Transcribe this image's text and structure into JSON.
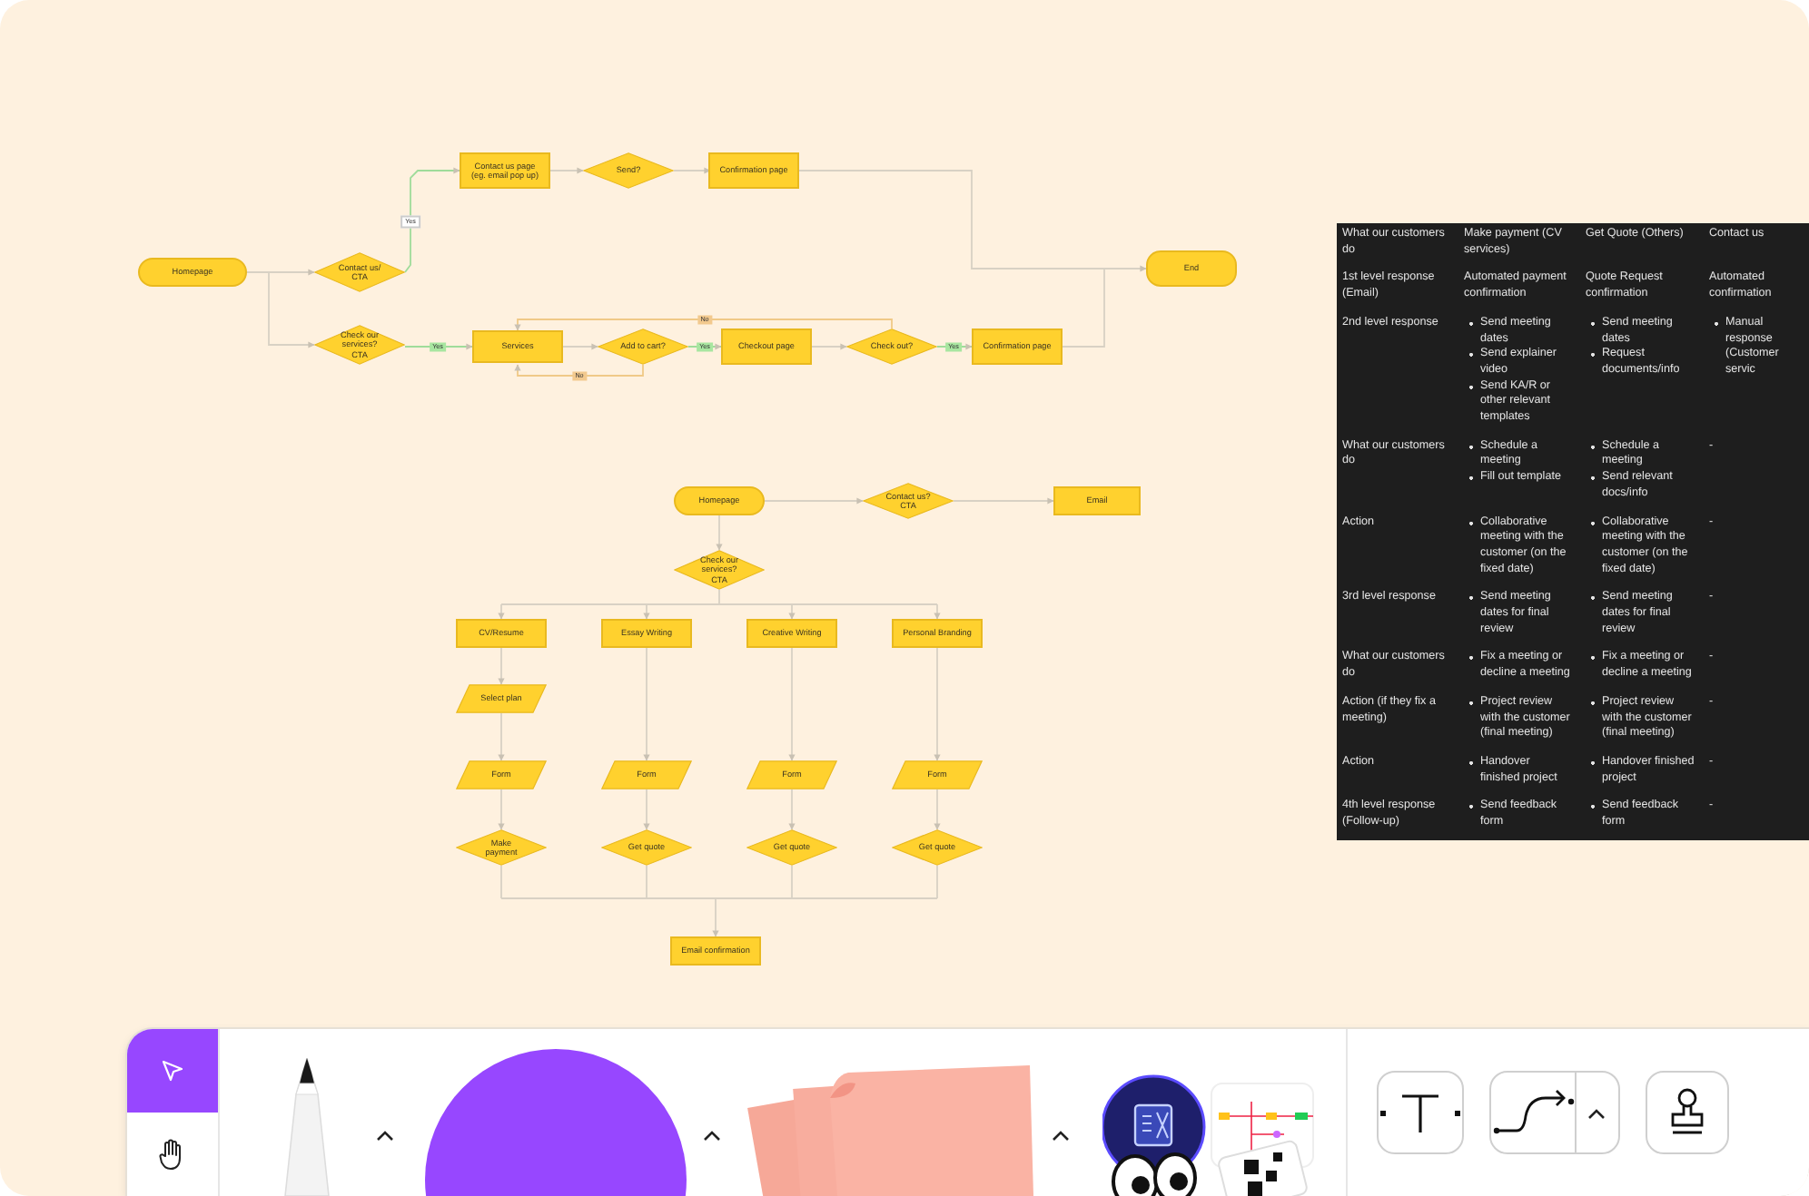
{
  "flowcharts": [
    {
      "nodes": [
        {
          "kind": "terminal",
          "label": "Homepage"
        },
        {
          "kind": "decision",
          "label": "Contact us/ CTA"
        },
        {
          "kind": "decision",
          "label": "Check our services? CTA"
        },
        {
          "kind": "process",
          "label": "Contact us page (eg. email pop up)"
        },
        {
          "kind": "decision",
          "label": "Send?"
        },
        {
          "kind": "process",
          "label": "Confirmation page"
        },
        {
          "kind": "terminal",
          "label": "End"
        },
        {
          "kind": "process",
          "label": "Services"
        },
        {
          "kind": "decision",
          "label": "Add to cart?"
        },
        {
          "kind": "process",
          "label": "Checkout page"
        },
        {
          "kind": "decision",
          "label": "Check out?"
        },
        {
          "kind": "process",
          "label": "Confirmation page"
        }
      ],
      "edge_labels": [
        {
          "kind": "plain",
          "label": "Yes"
        },
        {
          "kind": "yes",
          "label": "Yes"
        },
        {
          "kind": "no",
          "label": "No"
        },
        {
          "kind": "yes",
          "label": "Yes"
        },
        {
          "kind": "no",
          "label": "No"
        },
        {
          "kind": "yes",
          "label": "Yes"
        }
      ]
    },
    {
      "nodes": [
        {
          "kind": "terminal",
          "label": "Homepage"
        },
        {
          "kind": "decision",
          "label": "Contact us? CTA"
        },
        {
          "kind": "process",
          "label": "Email"
        },
        {
          "kind": "decision",
          "label": "Check our services? CTA"
        },
        {
          "kind": "process",
          "label": "CV/Resume"
        },
        {
          "kind": "process",
          "label": "Essay Writing"
        },
        {
          "kind": "process",
          "label": "Creative Writing"
        },
        {
          "kind": "process",
          "label": "Personal Branding"
        },
        {
          "kind": "data",
          "label": "Select plan"
        },
        {
          "kind": "data",
          "label": "Form"
        },
        {
          "kind": "data",
          "label": "Form"
        },
        {
          "kind": "data",
          "label": "Form"
        },
        {
          "kind": "data",
          "label": "Form"
        },
        {
          "kind": "decision",
          "label": "Make payment"
        },
        {
          "kind": "decision",
          "label": "Get quote"
        },
        {
          "kind": "decision",
          "label": "Get quote"
        },
        {
          "kind": "decision",
          "label": "Get quote"
        },
        {
          "kind": "process",
          "label": "Email confirmation"
        }
      ]
    }
  ],
  "table": {
    "rows": [
      {
        "cells": [
          {
            "kind": "text",
            "text": "What our customers do"
          },
          {
            "kind": "text",
            "text": "Make payment (CV services)"
          },
          {
            "kind": "text",
            "text": "Get Quote (Others)"
          },
          {
            "kind": "text",
            "text": "Contact us"
          }
        ]
      },
      {
        "cells": [
          {
            "kind": "text",
            "text": "1st level response (Email)"
          },
          {
            "kind": "text",
            "text": "Automated payment confirmation"
          },
          {
            "kind": "text",
            "text": "Quote Request confirmation"
          },
          {
            "kind": "text",
            "text": "Automated confirmation"
          }
        ]
      },
      {
        "cells": [
          {
            "kind": "text",
            "text": "2nd level response"
          },
          {
            "kind": "list",
            "items": [
              "Send meeting dates",
              "Send explainer video",
              "Send KA/R or other relevant templates"
            ]
          },
          {
            "kind": "list",
            "items": [
              "Send meeting dates",
              "Request documents/info"
            ]
          },
          {
            "kind": "list",
            "items": [
              "Manual response (Customer servic"
            ]
          }
        ]
      },
      {
        "cells": [
          {
            "kind": "text",
            "text": "What our customers do"
          },
          {
            "kind": "list",
            "items": [
              "Schedule a meeting",
              "Fill out template"
            ]
          },
          {
            "kind": "list",
            "items": [
              "Schedule a meeting",
              "Send relevant docs/info"
            ]
          },
          {
            "kind": "text",
            "text": "-"
          }
        ]
      },
      {
        "cells": [
          {
            "kind": "text",
            "text": "Action"
          },
          {
            "kind": "list",
            "items": [
              "Collaborative meeting with the customer (on the fixed date)"
            ]
          },
          {
            "kind": "list",
            "items": [
              "Collaborative meeting with the customer (on the fixed date)"
            ]
          },
          {
            "kind": "text",
            "text": "-"
          }
        ]
      },
      {
        "cells": [
          {
            "kind": "text",
            "text": "3rd level response"
          },
          {
            "kind": "list",
            "items": [
              "Send meeting dates for final review"
            ]
          },
          {
            "kind": "list",
            "items": [
              "Send meeting dates for final review"
            ]
          },
          {
            "kind": "text",
            "text": "-"
          }
        ]
      },
      {
        "cells": [
          {
            "kind": "text",
            "text": "What our customers do"
          },
          {
            "kind": "list",
            "items": [
              "Fix a meeting or decline a meeting"
            ]
          },
          {
            "kind": "list",
            "items": [
              "Fix a meeting or decline a meeting"
            ]
          },
          {
            "kind": "text",
            "text": "-"
          }
        ]
      },
      {
        "cells": [
          {
            "kind": "text",
            "text": "Action (if they fix a meeting)"
          },
          {
            "kind": "list",
            "items": [
              "Project review with the customer (final meeting)"
            ]
          },
          {
            "kind": "list",
            "items": [
              "Project review with the customer (final meeting)"
            ]
          },
          {
            "kind": "text",
            "text": "-"
          }
        ]
      },
      {
        "cells": [
          {
            "kind": "text",
            "text": "Action"
          },
          {
            "kind": "list",
            "items": [
              "Handover finished project"
            ]
          },
          {
            "kind": "list",
            "items": [
              "Handover finished project"
            ]
          },
          {
            "kind": "text",
            "text": "-"
          }
        ]
      },
      {
        "cells": [
          {
            "kind": "text",
            "text": "4th level response (Follow-up)"
          },
          {
            "kind": "list",
            "items": [
              "Send feedback form"
            ]
          },
          {
            "kind": "list",
            "items": [
              "Send feedback form"
            ]
          },
          {
            "kind": "text",
            "text": "-"
          }
        ]
      }
    ]
  },
  "toolbar": {
    "tools": [
      {
        "kind": "select",
        "selected": true
      },
      {
        "kind": "hand",
        "selected": false
      }
    ]
  }
}
